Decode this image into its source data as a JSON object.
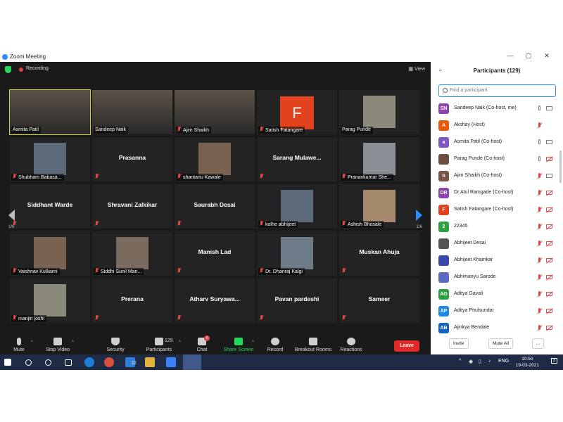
{
  "window": {
    "title": "Zoom Meeting",
    "min": "—",
    "max": "▢",
    "close": "✕"
  },
  "meeting": {
    "recording_label": "Recording",
    "view_label": "View",
    "page_left": "1/6",
    "page_right": "1/6",
    "tiles": [
      {
        "name": "Asmita Patil",
        "kind": "video",
        "active": true
      },
      {
        "name": "Sandeep Naik",
        "kind": "video"
      },
      {
        "name": "Ajim Shaikh",
        "kind": "video",
        "muted": true
      },
      {
        "name": "Satish Fatangare",
        "kind": "letter",
        "letter": "F",
        "muted": true
      },
      {
        "name": "Parag Punde",
        "kind": "photo"
      },
      {
        "name": "Shubham Babasa...",
        "kind": "photo",
        "muted": true
      },
      {
        "name": "Prasanna",
        "kind": "text",
        "muted": true
      },
      {
        "name": "shantanu Kawale",
        "kind": "photo",
        "muted": true
      },
      {
        "name": "Sarang  Mulawe...",
        "kind": "text",
        "muted": true
      },
      {
        "name": "Pranavkumar She...",
        "kind": "photo",
        "muted": true
      },
      {
        "name": "Siddhant Warde",
        "kind": "text",
        "muted": true
      },
      {
        "name": "Shravani Zalkikar",
        "kind": "text",
        "muted": true
      },
      {
        "name": "Saurabh Desai",
        "kind": "text",
        "muted": true
      },
      {
        "name": "kolhe abhijeet",
        "kind": "photo",
        "muted": true
      },
      {
        "name": "Ashish Bhosale",
        "kind": "photo",
        "muted": true
      },
      {
        "name": "Vaishnav Kulkarni",
        "kind": "photo",
        "muted": true
      },
      {
        "name": "Siddhi Sunil Man...",
        "kind": "photo",
        "muted": true
      },
      {
        "name": "Manish Lad",
        "kind": "text",
        "muted": true
      },
      {
        "name": "Dr. Dhanraj Kalgi",
        "kind": "photo",
        "muted": true
      },
      {
        "name": "Muskan Ahuja",
        "kind": "text",
        "muted": true
      },
      {
        "name": "manjiri joshi",
        "kind": "photo",
        "muted": true
      },
      {
        "name": "Prerana",
        "kind": "text",
        "muted": true
      },
      {
        "name": "Atharv  Suryawa...",
        "kind": "text",
        "muted": true
      },
      {
        "name": "Pavan pardeshi",
        "kind": "text",
        "muted": true
      },
      {
        "name": "Sameer",
        "kind": "text",
        "muted": true
      }
    ]
  },
  "toolbar": {
    "mute": "Mute",
    "stop_video": "Stop Video",
    "security": "Security",
    "participants": "Participants",
    "participants_count": "129",
    "chat": "Chat",
    "chat_badge": "4",
    "share_screen": "Share Screen",
    "record": "Record",
    "breakout": "Breakout Rooms",
    "reactions": "Reactions",
    "leave": "Leave"
  },
  "panel": {
    "title": "Participants (129)",
    "search_placeholder": "Find a participant",
    "participants": [
      {
        "initials": "SN",
        "color": "#8e44ad",
        "name": "Sandeep Naik (Co-host, me)",
        "mic": "on",
        "cam": "on"
      },
      {
        "initials": "A",
        "color": "#e8590c",
        "name": "Akshay (Host)",
        "mic": "off",
        "cam": "none"
      },
      {
        "initials": "a",
        "color": "#7e57c2",
        "name": "Asmita Patil (Co-host)",
        "mic": "on",
        "cam": "on"
      },
      {
        "initials": "",
        "color": "#6d4c41",
        "name": "Parag Punde (Co-host)",
        "mic": "on",
        "cam": "off"
      },
      {
        "initials": "S",
        "color": "#795548",
        "name": "Ajim Shaikh (Co-host)",
        "mic": "off",
        "cam": "on"
      },
      {
        "initials": "DR",
        "color": "#8e44ad",
        "name": "Dr.Atul Ramgade (Co-host)",
        "mic": "off",
        "cam": "off"
      },
      {
        "initials": "F",
        "color": "#e2431e",
        "name": "Satish Fatangare (Co-host)",
        "mic": "off",
        "cam": "off"
      },
      {
        "initials": "2",
        "color": "#2ea043",
        "name": "22345",
        "mic": "off",
        "cam": "off"
      },
      {
        "initials": "",
        "color": "#555555",
        "name": "Abhijeet Desai",
        "mic": "off",
        "cam": "off"
      },
      {
        "initials": "",
        "color": "#3949ab",
        "name": "Abhijeet Khamkar",
        "mic": "off",
        "cam": "off"
      },
      {
        "initials": "",
        "color": "#5c6bc0",
        "name": "Abhimanyu Sarode",
        "mic": "off",
        "cam": "off"
      },
      {
        "initials": "AG",
        "color": "#2ea043",
        "name": "Aditya Gavali",
        "mic": "off",
        "cam": "off"
      },
      {
        "initials": "AP",
        "color": "#1e88e5",
        "name": "Aditya Phulsundar",
        "mic": "off",
        "cam": "off"
      },
      {
        "initials": "AB",
        "color": "#1565c0",
        "name": "Ajinkya Bendale",
        "mic": "off",
        "cam": "off"
      }
    ],
    "invite": "Invite",
    "mute_all": "Mute All",
    "more": "..."
  },
  "taskbar": {
    "lang": "ENG",
    "time": "10:50",
    "date": "19-03-2021",
    "notif": "3",
    "tray_badge": "22"
  },
  "colors": {
    "accent": "#2d8cff",
    "leave": "#e02828",
    "muted": "#e04848",
    "active_speaker": "#cfd33b"
  }
}
